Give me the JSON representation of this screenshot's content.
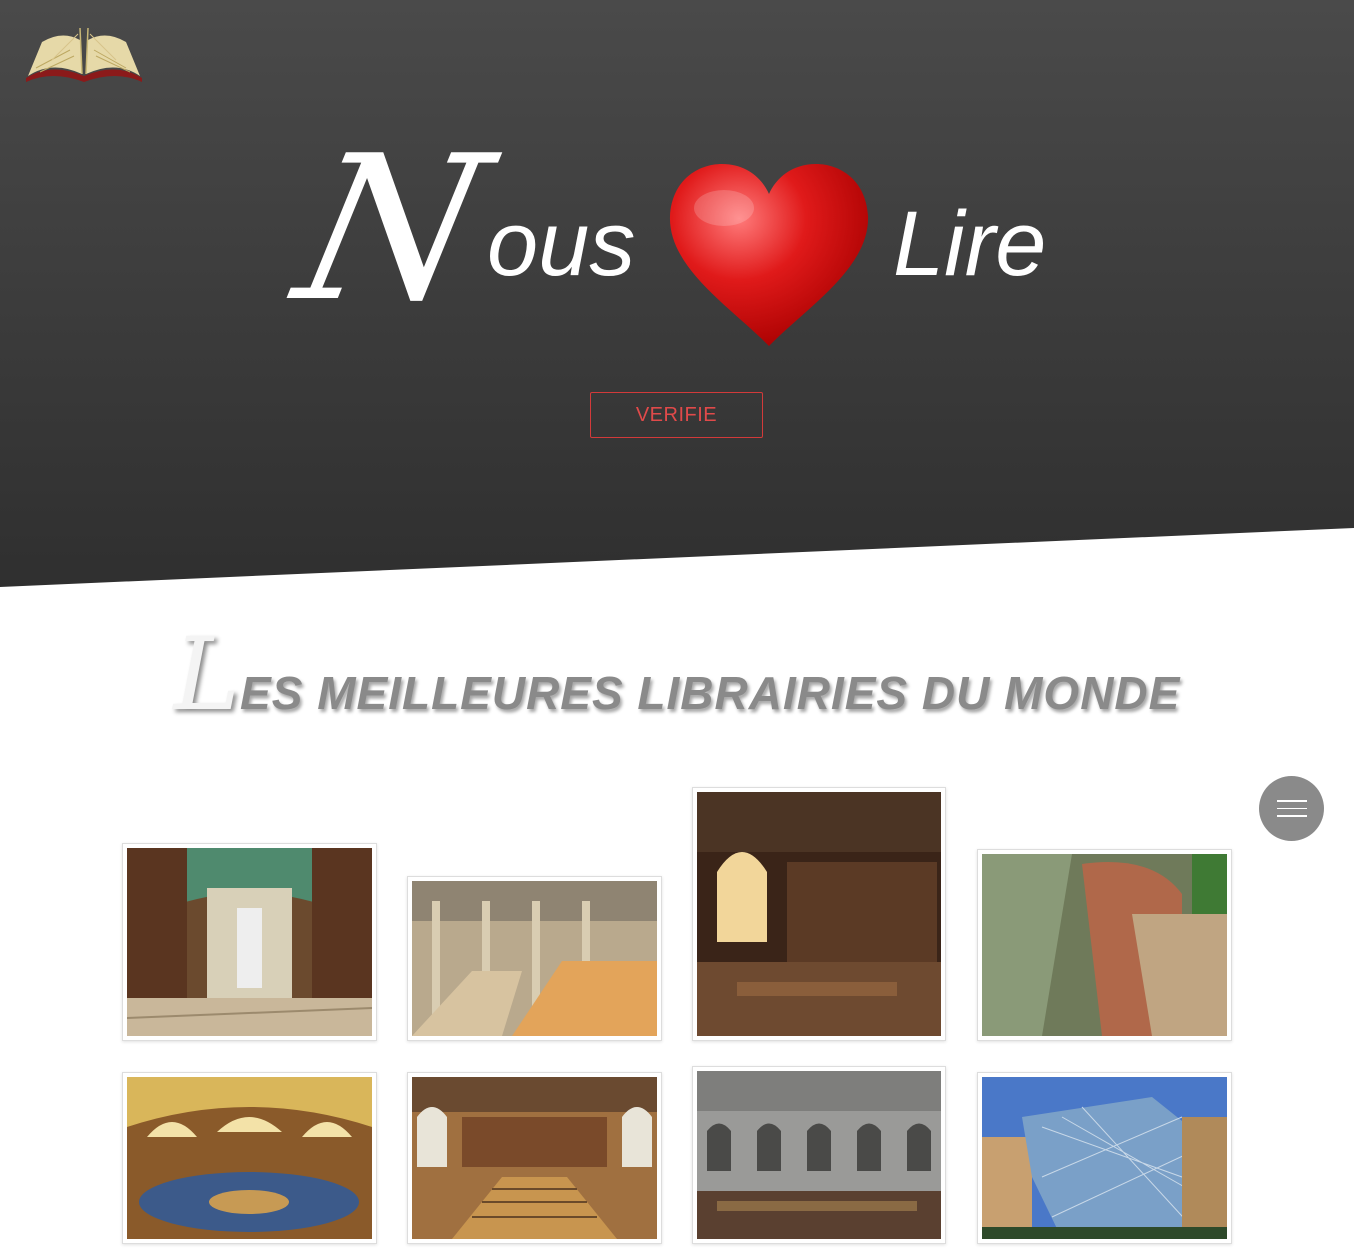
{
  "header": {
    "logo_icon": "open-book-icon",
    "title_initial": "N",
    "title_word1_rest": "ous",
    "title_heart_icon": "heart-icon",
    "title_word2": "Lire",
    "cta_label": "VERIFIE"
  },
  "section": {
    "heading_initial": "L",
    "heading_rest": "ES MEILLEURES LIBRAIRIES DU MONDE"
  },
  "menu": {
    "icon": "hamburger-menu-icon"
  },
  "gallery": {
    "items": [
      {
        "name": "library-photo-1",
        "alt": "baroque-library-hall"
      },
      {
        "name": "library-photo-2",
        "alt": "modern-reading-room"
      },
      {
        "name": "library-photo-3",
        "alt": "gothic-wood-library"
      },
      {
        "name": "library-photo-4",
        "alt": "aerial-library-building"
      },
      {
        "name": "library-photo-5",
        "alt": "domed-reading-room"
      },
      {
        "name": "library-photo-6",
        "alt": "grand-reading-room"
      },
      {
        "name": "library-photo-7",
        "alt": "arcaded-library-courtyard"
      },
      {
        "name": "library-photo-8",
        "alt": "glass-library-building"
      }
    ]
  },
  "colors": {
    "hero_dark": "#3b3b3b",
    "accent_red": "#e04a4a",
    "menu_grey": "#8a8a8a"
  }
}
